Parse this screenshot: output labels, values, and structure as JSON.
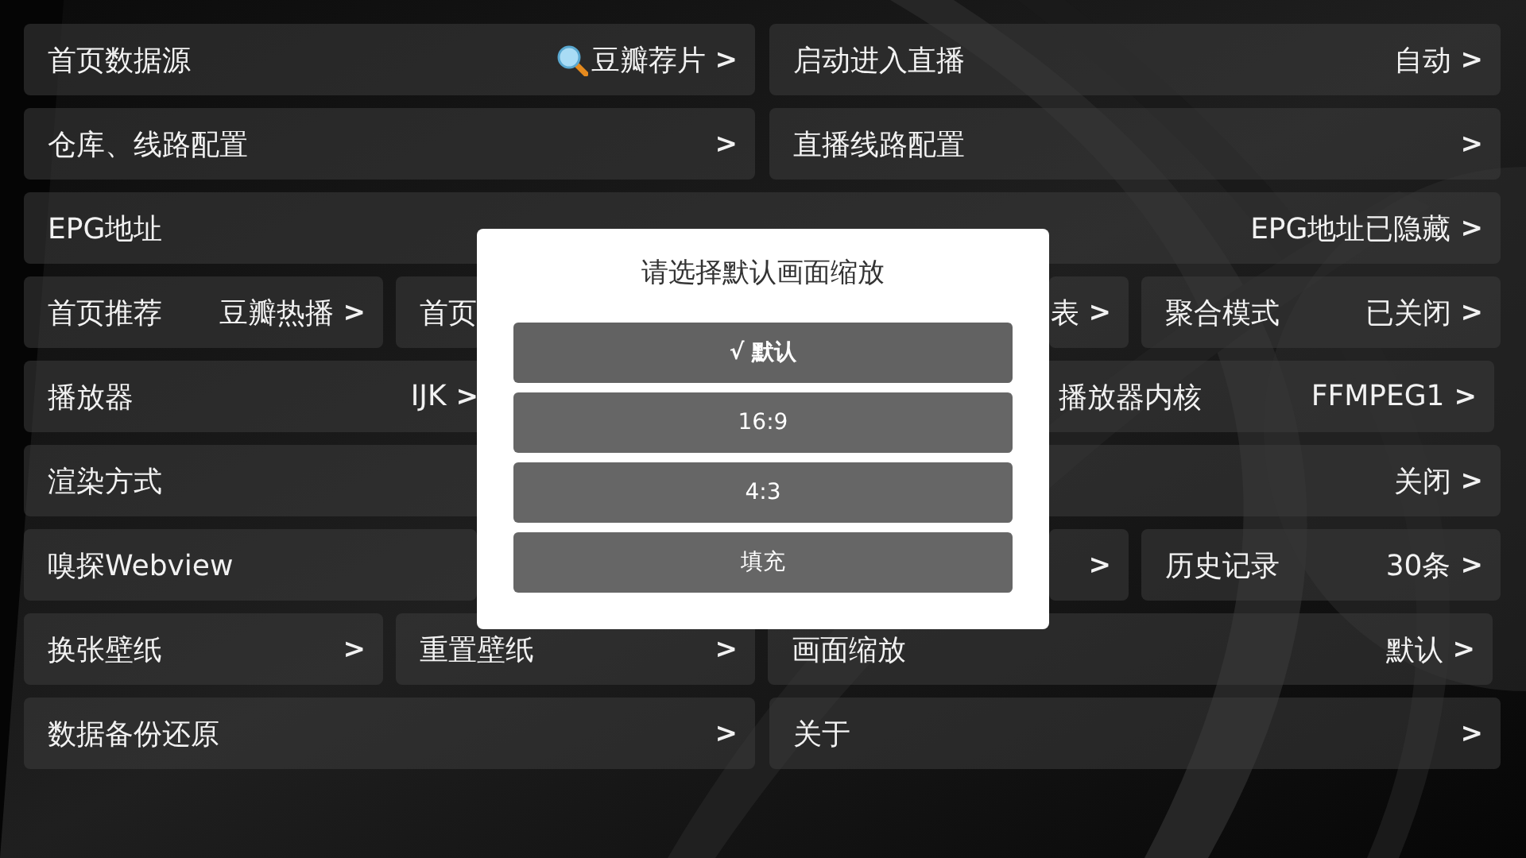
{
  "settings_rows": [
    {
      "tiles": [
        {
          "kind": "search_value",
          "label": "首页数据源",
          "value": "豆瓣荐片",
          "arrow": ">"
        },
        {
          "kind": "plain",
          "label": "启动进入直播",
          "value": "自动",
          "arrow": ">"
        }
      ]
    },
    {
      "tiles": [
        {
          "kind": "plain",
          "label": "仓库、线路配置",
          "arrow": ">"
        },
        {
          "kind": "plain",
          "label": "直播线路配置",
          "arrow": ">"
        }
      ]
    },
    {
      "tiles": [
        {
          "kind": "plain",
          "label": "EPG地址",
          "value": "EPG地址已隐藏",
          "arrow": ">"
        }
      ]
    },
    {
      "tiles": [
        {
          "kind": "plain",
          "label": "首页推荐",
          "value": "豆瓣热播",
          "arrow": ">"
        },
        {
          "kind": "plain",
          "label": "首页"
        },
        {
          "kind": "plain",
          "value": "表",
          "arrow": ">"
        },
        {
          "kind": "plain",
          "label": "聚合模式",
          "value": "已关闭",
          "arrow": ">"
        }
      ]
    },
    {
      "tiles": [
        {
          "kind": "plain",
          "label": "播放器",
          "value": "IJK",
          "arrow": ">"
        },
        {
          "kind": "plain",
          "label": "播放器内核",
          "value": "FFMPEG1",
          "arrow": ">"
        }
      ]
    },
    {
      "tiles": [
        {
          "kind": "plain",
          "label": "渲染方式",
          "value": "关闭",
          "arrow": ">"
        }
      ]
    },
    {
      "tiles": [
        {
          "kind": "plain",
          "label": "嗅探Webview"
        },
        {
          "kind": "plain",
          "arrow": ">"
        },
        {
          "kind": "plain",
          "label": "历史记录",
          "value": "30条",
          "arrow": ">"
        }
      ]
    },
    {
      "tiles": [
        {
          "kind": "plain",
          "label": "换张壁纸",
          "arrow": ">"
        },
        {
          "kind": "plain",
          "label": "重置壁纸",
          "arrow": ">"
        },
        {
          "kind": "plain",
          "label": "画面缩放",
          "value": "默认",
          "arrow": ">"
        }
      ]
    },
    {
      "tiles": [
        {
          "kind": "plain",
          "label": "数据备份还原",
          "arrow": ">"
        },
        {
          "kind": "plain",
          "label": "关于",
          "arrow": ">"
        }
      ]
    }
  ],
  "dialog": {
    "title": "请选择默认画面缩放",
    "check_mark": "√",
    "options": [
      {
        "label": "默认",
        "selected": true
      },
      {
        "label": "16:9",
        "selected": false
      },
      {
        "label": "4:3",
        "selected": false
      },
      {
        "label": "填充",
        "selected": false
      }
    ]
  }
}
